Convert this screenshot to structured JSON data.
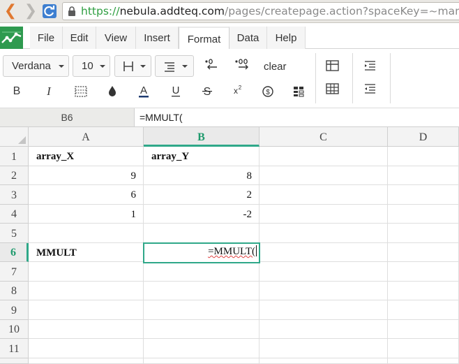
{
  "browser": {
    "url_scheme": "https://",
    "url_host": "nebula.addteq.com",
    "url_path": "/pages/createpage.action?spaceKey=~manoj.kum"
  },
  "menu": {
    "items": [
      "File",
      "Edit",
      "View",
      "Insert",
      "Format",
      "Data",
      "Help"
    ],
    "active": "Format"
  },
  "toolbar": {
    "font_family": "Verdana",
    "font_size": "10",
    "clear_label": "clear",
    "row1_icons": [
      "borders-icon",
      "align-icon",
      "decrease-decimal-icon",
      "increase-decimal-icon"
    ],
    "row2_icons": [
      "bold-icon",
      "italic-icon",
      "merge-cells-icon",
      "fill-color-icon",
      "text-color-icon",
      "underline-icon",
      "strikethrough-icon",
      "superscript-icon",
      "currency-icon",
      "format-table-icon"
    ]
  },
  "formula_bar": {
    "cell_ref": "B6",
    "formula": "=MMULT("
  },
  "sheet": {
    "columns": [
      "A",
      "B",
      "C",
      "D"
    ],
    "rows": [
      "1",
      "2",
      "3",
      "4",
      "5",
      "6",
      "7",
      "8",
      "9",
      "10",
      "11"
    ],
    "selected_column": "B",
    "selected_row": "6",
    "cells": {
      "A1": "array_X",
      "B1": "array_Y",
      "A2": "9",
      "B2": "8",
      "A3": "6",
      "B3": "2",
      "A4": "1",
      "B4": "-2",
      "A6": "MMULT",
      "B6": "=MMULT("
    }
  },
  "colors": {
    "accent": "#2fa889",
    "logo": "#2e9a4f",
    "url_scheme": "#2f9e41",
    "back_arrow": "#e07830"
  }
}
